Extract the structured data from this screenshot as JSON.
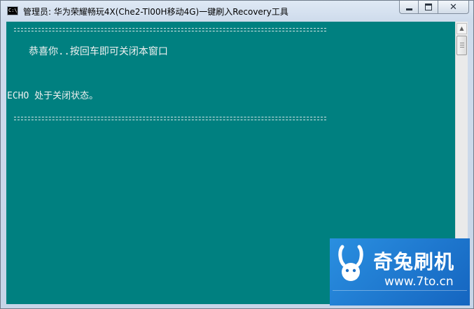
{
  "window": {
    "title": "管理员:  华为荣耀畅玩4X(Che2-Tl00H移动4G)一键刷入Recovery工具",
    "icon_label": "C:\\",
    "buttons": [
      "minimize-icon",
      "maximize-icon",
      "close-icon"
    ]
  },
  "console": {
    "background": "#008080",
    "text_color": "#f0f0f0",
    "message": "恭喜你..按回车即可关闭本窗口",
    "echo_status": "ECHO 处于关闭状态。"
  },
  "scrollbar": {
    "up_arrow": "▲",
    "down_arrow": "▼"
  },
  "watermark": {
    "name": "奇兔刷机",
    "url": "www.7to.cn",
    "color": "#1e88e5"
  }
}
